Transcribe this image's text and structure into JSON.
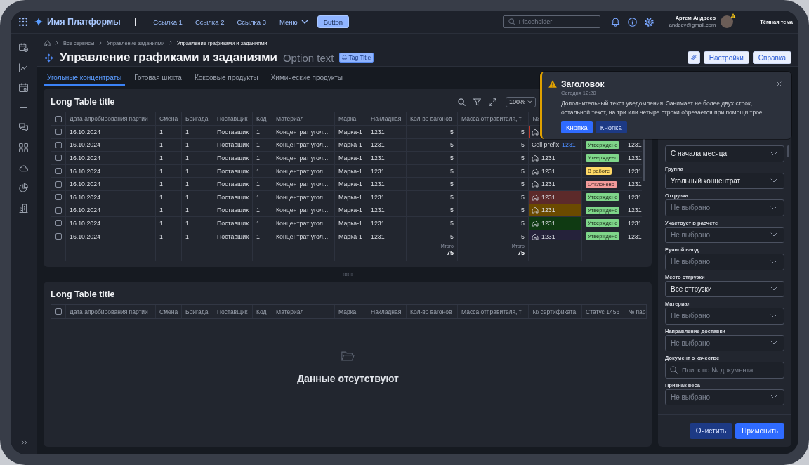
{
  "header": {
    "brand": "Имя Платформы",
    "links": [
      {
        "label": "Ссылка 1"
      },
      {
        "label": "Ссылка 2"
      },
      {
        "label": "Ссылка 3"
      }
    ],
    "menu": "Меню",
    "button": "Button",
    "search": {
      "placeholder": "Placeholder"
    },
    "user": {
      "name": "Артем Андреев",
      "email": "andeev@gmail.com",
      "warning": true
    },
    "theme_toggle": "Тёмная тема"
  },
  "page": {
    "breadcrumbs": [
      {
        "label": "Все сервисы",
        "current": false
      },
      {
        "label": "Управление заданиями",
        "current": false
      },
      {
        "label": "Управление графиками и заданиями",
        "current": true
      }
    ],
    "title": "Управление графиками и заданиями",
    "option_text": "Option text",
    "tag": "Tag Title",
    "actions": [
      "Настройки",
      "Справка"
    ]
  },
  "tabs": [
    {
      "label": "Угольные концентраты",
      "selected": true
    },
    {
      "label": "Готовая шихта",
      "selected": false
    },
    {
      "label": "Коксовые продукты",
      "selected": false
    },
    {
      "label": "Химические продукты",
      "selected": false
    }
  ],
  "tables": [
    {
      "title": "Long Table title",
      "zoom": "100%",
      "all_selected": false,
      "columns": [
        "Дата апробирования партии",
        "Смена",
        "Бригада",
        "Поставщик",
        "Код",
        "Материал",
        "Марка",
        "Накладная",
        "Кол-во вагонов",
        "Масса отправителя, т",
        "№"
      ],
      "rows": [
        {
          "selected": false,
          "cells": [
            "16.10.2024",
            "1",
            "1",
            "Поставщик",
            "1",
            "Концентрат угол...",
            "Марка-1",
            "1231",
            "5",
            "5"
          ],
          "certificate": {
            "kind": "icon",
            "error": true
          }
        },
        {
          "selected": false,
          "cells": [
            "16.10.2024",
            "1",
            "1",
            "Поставщик",
            "1",
            "Концентрат угол...",
            "Марка-1",
            "1231",
            "5",
            "5"
          ],
          "certificate": {
            "kind": "prefix",
            "prefix": "Cell prefix",
            "text": "1231",
            "error": false
          },
          "status": {
            "label": "Утверждено",
            "color": "#7fd68a"
          },
          "column_14": "1231"
        },
        {
          "selected": false,
          "cells": [
            "16.10.2024",
            "1",
            "1",
            "Поставщик",
            "1",
            "Концентрат угол...",
            "Марка-1",
            "1231",
            "5",
            "5"
          ],
          "certificate": {
            "kind": "icon",
            "text": "1231",
            "error": false
          },
          "status": {
            "label": "Утверждено",
            "color": "#7fd68a"
          },
          "column_14": "1231"
        },
        {
          "selected": false,
          "cells": [
            "16.10.2024",
            "1",
            "1",
            "Поставщик",
            "1",
            "Концентрат угол...",
            "Марка-1",
            "1231",
            "5",
            "5"
          ],
          "certificate": {
            "kind": "icon",
            "text": "1231",
            "error": false
          },
          "status": {
            "label": "В работе",
            "color": "#ffd966"
          },
          "column_14": "1231"
        },
        {
          "selected": false,
          "cells": [
            "16.10.2024",
            "1",
            "1",
            "Поставщик",
            "1",
            "Концентрат угол...",
            "Марка-1",
            "1231",
            "5",
            "5"
          ],
          "certificate": {
            "kind": "icon",
            "text": "1231",
            "error": false
          },
          "status": {
            "label": "Отклонено",
            "color": "#f29a9a"
          },
          "column_14": "1231"
        },
        {
          "selected": false,
          "cells": [
            "16.10.2024",
            "1",
            "1",
            "Поставщик",
            "1",
            "Концентрат угол...",
            "Марка-1",
            "1231",
            "5",
            "5"
          ],
          "certificate": {
            "kind": "icon",
            "text": "1231",
            "error": false,
            "color": "#5c2a2a"
          },
          "status": {
            "label": "Утверждено",
            "color": "#7fd68a"
          },
          "column_14": "1231"
        },
        {
          "selected": false,
          "cells": [
            "16.10.2024",
            "1",
            "1",
            "Поставщик",
            "1",
            "Концентрат угол...",
            "Марка-1",
            "1231",
            "5",
            "5"
          ],
          "certificate": {
            "kind": "icon",
            "text": "1231",
            "error": false,
            "color": "#6b4a00"
          },
          "status": {
            "label": "Утверждено",
            "color": "#7fd68a"
          },
          "column_14": "1231"
        },
        {
          "selected": false,
          "cells": [
            "16.10.2024",
            "1",
            "1",
            "Поставщик",
            "1",
            "Концентрат угол...",
            "Марка-1",
            "1231",
            "5",
            "5"
          ],
          "certificate": {
            "kind": "icon",
            "text": "1231",
            "error": false,
            "color": "#0f3a12"
          },
          "status": {
            "label": "Утверждено",
            "color": "#7fd68a"
          },
          "column_14": "1231"
        },
        {
          "selected": false,
          "cells": [
            "16.10.2024",
            "1",
            "1",
            "Поставщик",
            "1",
            "Концентрат угол...",
            "Марка-1",
            "1231",
            "5",
            "5"
          ],
          "certificate": {
            "kind": "icon",
            "text": "1231",
            "error": false,
            "color": "#25223a"
          },
          "status": {
            "label": "Утверждено",
            "color": "#7fd68a"
          },
          "column_14": "1231"
        }
      ],
      "totals": [
        {
          "label": "Итого",
          "value": "75"
        },
        {
          "label": "Итого",
          "value": "75"
        }
      ]
    },
    {
      "title": "Long Table title",
      "all_selected": false,
      "columns": [
        "Дата апробирования партии",
        "Смена",
        "Бригада",
        "Поставщик",
        "Код",
        "Материал",
        "Марка",
        "Накладная",
        "Кол-во вагонов",
        "Масса отправителя, т",
        "№ сертификата",
        "Статус 1456",
        "№ пар"
      ],
      "empty_text": "Данные отсутствуют"
    }
  ],
  "filters": {
    "fields": [
      {
        "kind": "select",
        "value": "С начала месяца"
      },
      {
        "kind": "select",
        "label": "Группа",
        "value": "Угольный концентрат"
      },
      {
        "kind": "select",
        "label": "Отгрузка",
        "placeholder": "Не выбрано"
      },
      {
        "kind": "select",
        "label": "Участвует в расчете",
        "placeholder": "Не выбрано"
      },
      {
        "kind": "select",
        "label": "Ручной ввод",
        "placeholder": "Не выбрано"
      },
      {
        "kind": "select",
        "label": "Место отгрузки",
        "value": "Все отгрузки"
      },
      {
        "kind": "select",
        "label": "Материал",
        "placeholder": "Не выбрано"
      },
      {
        "kind": "select",
        "label": "Направление доставки",
        "placeholder": "Не выбрано"
      },
      {
        "kind": "search",
        "label": "Документ о качестве",
        "placeholder": "Поиск по № документа"
      },
      {
        "kind": "select",
        "label": "Признак веса",
        "placeholder": "Не выбрано"
      }
    ],
    "buttons": [
      {
        "label": "Очистить",
        "kind": "secondary"
      },
      {
        "label": "Применить",
        "kind": "primary"
      }
    ]
  },
  "notification": {
    "kind": "warning",
    "title": "Заголовок",
    "time": "Сегодня 12:20",
    "text": "Дополнительный текст уведомления. Занимает не более двух строк, остальной текст, на три или четыре строки обрезается при помощи трое…",
    "buttons": [
      {
        "label": "Кнопка",
        "kind": "primary"
      },
      {
        "label": "Кнопка",
        "kind": "secondary"
      }
    ]
  }
}
